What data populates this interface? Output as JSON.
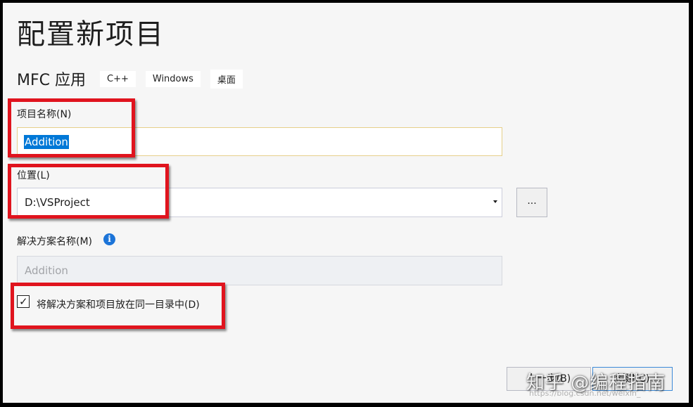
{
  "header": {
    "title": "配置新项目",
    "subtitle": "MFC 应用",
    "tags": [
      "C++",
      "Windows",
      "桌面"
    ]
  },
  "project_name": {
    "label": "项目名称(N)",
    "value": "Addition"
  },
  "location": {
    "label": "位置(L)",
    "value": "D:\\VSProject",
    "browse_label": "..."
  },
  "solution_name": {
    "label": "解决方案名称(M)",
    "value": "Addition",
    "info_icon": "i"
  },
  "same_dir_checkbox": {
    "label": "将解决方案和项目放在同一目录中(D)",
    "checked": true,
    "mark": "✓"
  },
  "footer": {
    "back_label": "上一步(B)",
    "create_label": "创建(C)"
  },
  "watermark": {
    "text": "知乎 @编程指南",
    "url": "https://blog.csdn.net/weixin_"
  },
  "colors": {
    "highlight_box": "#e0141e",
    "selection": "#0078d7",
    "info": "#1c74d8"
  }
}
